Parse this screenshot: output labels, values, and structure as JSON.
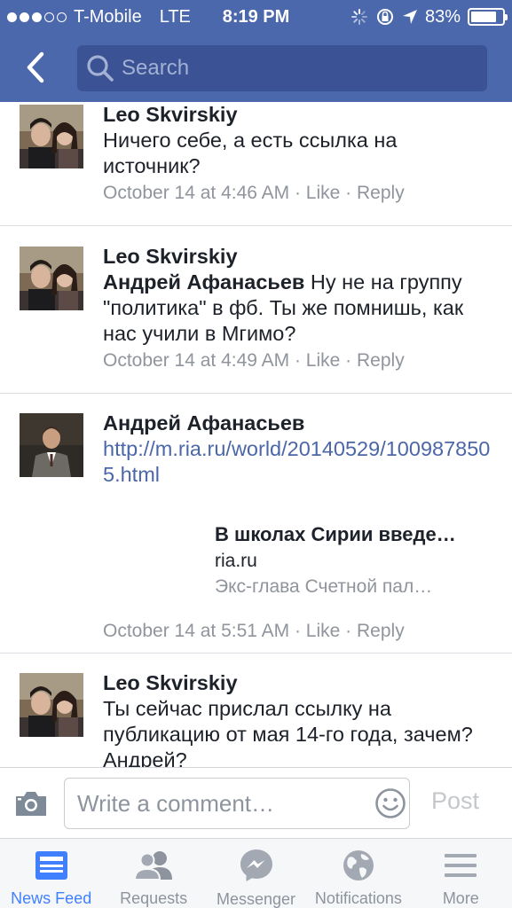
{
  "status_bar": {
    "carrier": "T-Mobile",
    "network": "LTE",
    "time": "8:19 PM",
    "battery_percent": "83%",
    "battery_level": 0.83,
    "signal_bars_filled": 3,
    "signal_bars_total": 5
  },
  "header": {
    "search_placeholder": "Search",
    "background_color": "#4b68ad"
  },
  "comments": [
    {
      "author": "Leo Skvirskiy",
      "text": "Ничего себе, а есть ссылка на источник?",
      "timestamp": "October 14 at 4:46 AM",
      "like": "Like",
      "reply": "Reply"
    },
    {
      "author": "Leo Skvirskiy",
      "mention": "Андрей Афанасьев",
      "text": " Ну не на группу \"политика\" в фб. Ты же помнишь, как нас учили в Мгимо?",
      "timestamp": "October 14 at 4:49 AM",
      "like": "Like",
      "reply": "Reply"
    },
    {
      "author": "Андрей Афанасьев",
      "link": "http://m.ria.ru/world/20140529/1009878505.html",
      "preview": {
        "title": "В школах Сирии введе…",
        "domain": "ria.ru",
        "description": "Экс-глава Счетной пал…"
      },
      "timestamp": "October 14 at 5:51 AM",
      "like": "Like",
      "reply": "Reply"
    },
    {
      "author": "Leo Skvirskiy",
      "text": "Ты сейчас прислал ссылку на публикацию от мая 14-го года, зачем? Андрей?"
    }
  ],
  "composer": {
    "placeholder": "Write a comment…",
    "post_label": "Post"
  },
  "tabbar": {
    "tabs": [
      {
        "label": "News Feed",
        "active": true
      },
      {
        "label": "Requests",
        "active": false
      },
      {
        "label": "Messenger",
        "active": false
      },
      {
        "label": "Notifications",
        "active": false
      },
      {
        "label": "More",
        "active": false
      }
    ]
  },
  "colors": {
    "brand_blue": "#4b68ad",
    "link_blue": "#4b67a8",
    "active_tab": "#4080ff",
    "meta_gray": "#90949c"
  }
}
